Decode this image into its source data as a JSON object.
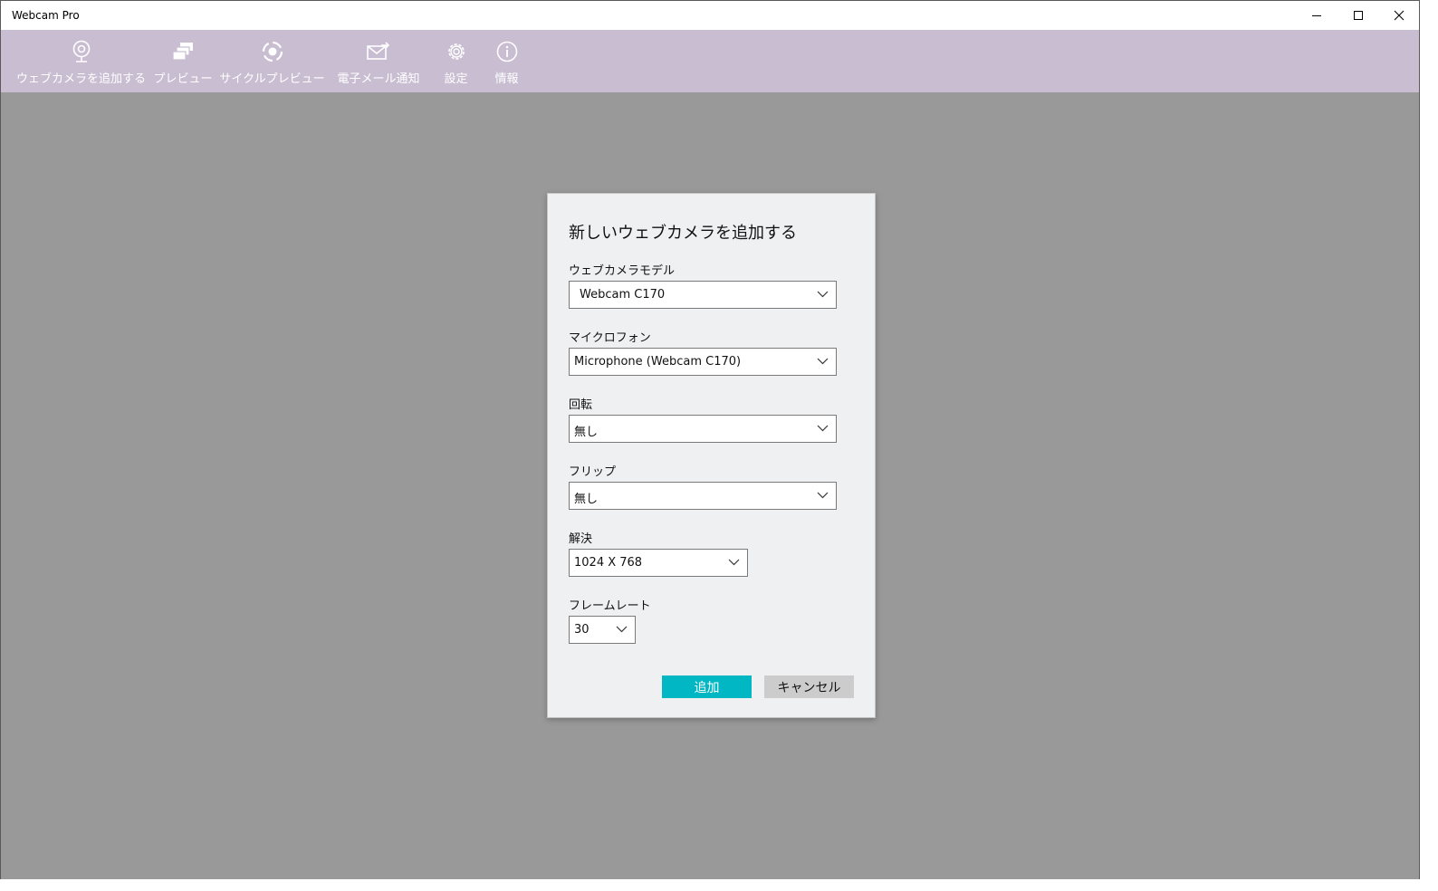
{
  "window": {
    "title": "Webcam Pro"
  },
  "toolbar": {
    "items": [
      {
        "label": "ウェブカメラを追加する",
        "icon": "webcam-icon"
      },
      {
        "label": "プレビュー",
        "icon": "preview-icon"
      },
      {
        "label": "サイクルプレビュー",
        "icon": "cycle-icon"
      },
      {
        "label": "電子メール通知",
        "icon": "email-icon"
      },
      {
        "label": "設定",
        "icon": "gear-icon"
      },
      {
        "label": "情報",
        "icon": "info-icon"
      }
    ]
  },
  "dialog": {
    "title": "新しいウェブカメラを追加する",
    "fields": [
      {
        "label": "ウェブカメラモデル",
        "value": "Webcam C170"
      },
      {
        "label": "マイクロフォン",
        "value": "Microphone (Webcam C170)"
      },
      {
        "label": "回転",
        "value": "無し"
      },
      {
        "label": "フリップ",
        "value": "無し"
      },
      {
        "label": "解決",
        "value": "1024 X 768"
      },
      {
        "label": "フレームレート",
        "value": "30"
      }
    ],
    "add_label": "追加",
    "cancel_label": "キャンセル"
  },
  "colors": {
    "toolbar_bg": "#c8bdd1",
    "backdrop": "#999999",
    "dialog_bg": "#eff0f2",
    "accent": "#00b7c3"
  }
}
